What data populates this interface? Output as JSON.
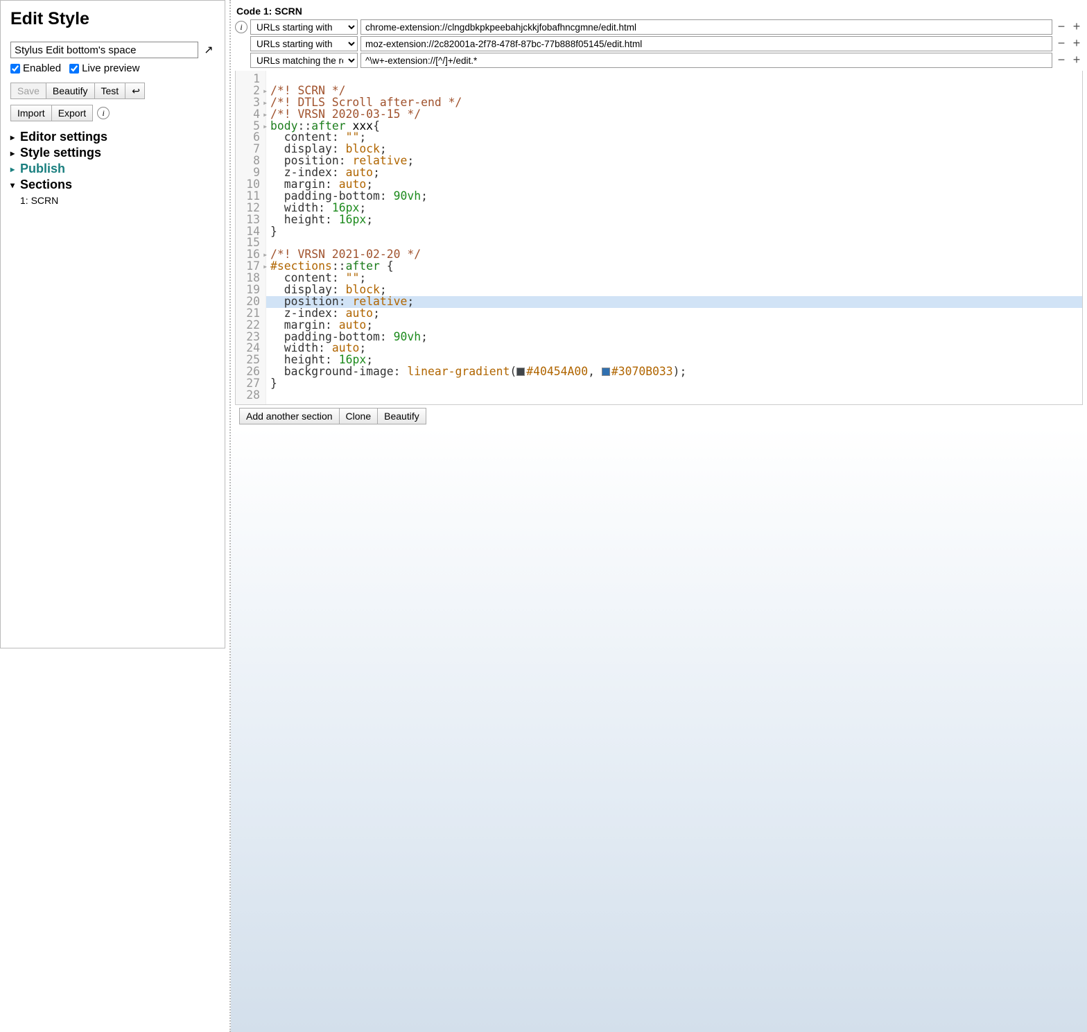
{
  "sidebar": {
    "title": "Edit Style",
    "style_name": "Stylus Edit bottom's space",
    "enabled_label": "Enabled",
    "live_preview_label": "Live preview",
    "buttons": {
      "save": "Save",
      "beautify": "Beautify",
      "test": "Test",
      "arrow": "↩",
      "import": "Import",
      "export": "Export"
    },
    "collapsibles": {
      "editor": "Editor settings",
      "style": "Style settings",
      "publish": "Publish",
      "sections": "Sections"
    },
    "section_items": [
      "1: SCRN"
    ]
  },
  "section": {
    "code_label": "Code 1: SCRN",
    "applies": [
      {
        "type": "URLs starting with",
        "value": "chrome-extension://clngdbkpkpeebahjckkjfobafhncgmne/edit.html"
      },
      {
        "type": "URLs starting with",
        "value": "moz-extension://2c82001a-2f78-478f-87bc-77b888f05145/edit.html"
      },
      {
        "type": "URLs matching the regexp",
        "value": "^\\w+-extension://[^/]+/edit.*"
      }
    ],
    "actions": {
      "add_section": "Add another section",
      "clone": "Clone",
      "beautify": "Beautify"
    }
  },
  "editor": {
    "lines": [
      {
        "n": 1,
        "raw": ""
      },
      {
        "n": 2,
        "fold": true,
        "tokens": [
          [
            "comment",
            "/*! SCRN */"
          ]
        ]
      },
      {
        "n": 3,
        "fold": true,
        "tokens": [
          [
            "comment",
            "/*! DTLS Scroll after-end */"
          ]
        ]
      },
      {
        "n": 4,
        "fold": true,
        "tokens": [
          [
            "comment",
            "/*! VRSN 2020-03-15 */"
          ]
        ]
      },
      {
        "n": 5,
        "fold": true,
        "tokens": [
          [
            "tag",
            "body"
          ],
          [
            "punct",
            "::"
          ],
          [
            "pseudo",
            "after"
          ],
          [
            "plain",
            " xxx"
          ],
          [
            "punct",
            "{"
          ]
        ]
      },
      {
        "n": 6,
        "tokens": [
          [
            "plain",
            "  "
          ],
          [
            "prop",
            "content"
          ],
          [
            "punct",
            ": "
          ],
          [
            "val",
            "\"\""
          ],
          [
            "punct",
            ";"
          ]
        ]
      },
      {
        "n": 7,
        "tokens": [
          [
            "plain",
            "  "
          ],
          [
            "prop",
            "display"
          ],
          [
            "punct",
            ": "
          ],
          [
            "val",
            "block"
          ],
          [
            "punct",
            ";"
          ]
        ]
      },
      {
        "n": 8,
        "tokens": [
          [
            "plain",
            "  "
          ],
          [
            "prop",
            "position"
          ],
          [
            "punct",
            ": "
          ],
          [
            "val",
            "relative"
          ],
          [
            "punct",
            ";"
          ]
        ]
      },
      {
        "n": 9,
        "tokens": [
          [
            "plain",
            "  "
          ],
          [
            "prop",
            "z-index"
          ],
          [
            "punct",
            ": "
          ],
          [
            "val",
            "auto"
          ],
          [
            "punct",
            ";"
          ]
        ]
      },
      {
        "n": 10,
        "tokens": [
          [
            "plain",
            "  "
          ],
          [
            "prop",
            "margin"
          ],
          [
            "punct",
            ": "
          ],
          [
            "val",
            "auto"
          ],
          [
            "punct",
            ";"
          ]
        ]
      },
      {
        "n": 11,
        "tokens": [
          [
            "plain",
            "  "
          ],
          [
            "prop",
            "padding-bottom"
          ],
          [
            "punct",
            ": "
          ],
          [
            "num",
            "90vh"
          ],
          [
            "punct",
            ";"
          ]
        ]
      },
      {
        "n": 12,
        "tokens": [
          [
            "plain",
            "  "
          ],
          [
            "prop",
            "width"
          ],
          [
            "punct",
            ": "
          ],
          [
            "num",
            "16px"
          ],
          [
            "punct",
            ";"
          ]
        ]
      },
      {
        "n": 13,
        "tokens": [
          [
            "plain",
            "  "
          ],
          [
            "prop",
            "height"
          ],
          [
            "punct",
            ": "
          ],
          [
            "num",
            "16px"
          ],
          [
            "punct",
            ";"
          ]
        ]
      },
      {
        "n": 14,
        "tokens": [
          [
            "punct",
            "}"
          ]
        ]
      },
      {
        "n": 15,
        "raw": ""
      },
      {
        "n": 16,
        "fold": true,
        "tokens": [
          [
            "comment",
            "/*! VRSN 2021-02-20 */"
          ]
        ]
      },
      {
        "n": 17,
        "fold": true,
        "tokens": [
          [
            "id",
            "#sections"
          ],
          [
            "punct",
            "::"
          ],
          [
            "pseudo",
            "after"
          ],
          [
            "plain",
            " "
          ],
          [
            "punct",
            "{"
          ]
        ]
      },
      {
        "n": 18,
        "tokens": [
          [
            "plain",
            "  "
          ],
          [
            "prop",
            "content"
          ],
          [
            "punct",
            ": "
          ],
          [
            "val",
            "\"\""
          ],
          [
            "punct",
            ";"
          ]
        ]
      },
      {
        "n": 19,
        "tokens": [
          [
            "plain",
            "  "
          ],
          [
            "prop",
            "display"
          ],
          [
            "punct",
            ": "
          ],
          [
            "val",
            "block"
          ],
          [
            "punct",
            ";"
          ]
        ]
      },
      {
        "n": 20,
        "highlight": true,
        "tokens": [
          [
            "plain",
            "  "
          ],
          [
            "prop",
            "position"
          ],
          [
            "punct",
            ": "
          ],
          [
            "val",
            "relative"
          ],
          [
            "punct",
            ";"
          ]
        ]
      },
      {
        "n": 21,
        "tokens": [
          [
            "plain",
            "  "
          ],
          [
            "prop",
            "z-index"
          ],
          [
            "punct",
            ": "
          ],
          [
            "val",
            "auto"
          ],
          [
            "punct",
            ";"
          ]
        ]
      },
      {
        "n": 22,
        "tokens": [
          [
            "plain",
            "  "
          ],
          [
            "prop",
            "margin"
          ],
          [
            "punct",
            ": "
          ],
          [
            "val",
            "auto"
          ],
          [
            "punct",
            ";"
          ]
        ]
      },
      {
        "n": 23,
        "tokens": [
          [
            "plain",
            "  "
          ],
          [
            "prop",
            "padding-bottom"
          ],
          [
            "punct",
            ": "
          ],
          [
            "num",
            "90vh"
          ],
          [
            "punct",
            ";"
          ]
        ]
      },
      {
        "n": 24,
        "tokens": [
          [
            "plain",
            "  "
          ],
          [
            "prop",
            "width"
          ],
          [
            "punct",
            ": "
          ],
          [
            "val",
            "auto"
          ],
          [
            "punct",
            ";"
          ]
        ]
      },
      {
        "n": 25,
        "tokens": [
          [
            "plain",
            "  "
          ],
          [
            "prop",
            "height"
          ],
          [
            "punct",
            ": "
          ],
          [
            "num",
            "16px"
          ],
          [
            "punct",
            ";"
          ]
        ]
      },
      {
        "n": 26,
        "tokens": [
          [
            "plain",
            "  "
          ],
          [
            "prop",
            "background-image"
          ],
          [
            "punct",
            ": "
          ],
          [
            "val",
            "linear-gradient"
          ],
          [
            "punct",
            "("
          ],
          [
            "swatch",
            "#40454A"
          ],
          [
            "id",
            "#40454A00"
          ],
          [
            "punct",
            ", "
          ],
          [
            "swatch",
            "#3070B0"
          ],
          [
            "id",
            "#3070B033"
          ],
          [
            "punct",
            ");"
          ]
        ]
      },
      {
        "n": 27,
        "tokens": [
          [
            "punct",
            "}"
          ]
        ]
      },
      {
        "n": 28,
        "raw": ""
      }
    ]
  }
}
